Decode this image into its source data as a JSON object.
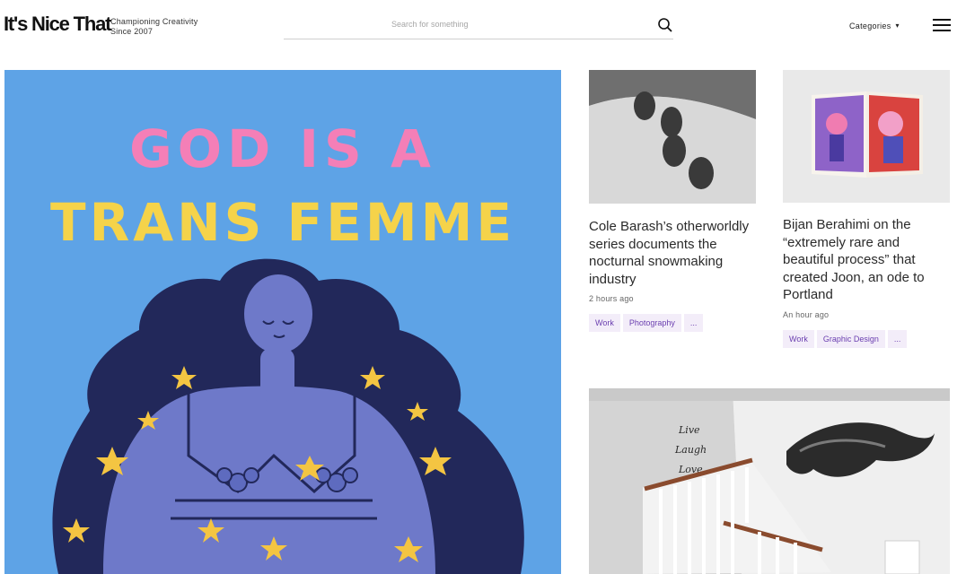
{
  "header": {
    "logo": "It's Nice That",
    "tagline_line1": "Championing Creativity",
    "tagline_line2": "Since 2007",
    "search_placeholder": "Search for something",
    "categories_label": "Categories"
  },
  "hero": {
    "line1": "GOD IS A",
    "line2": "TRANS FEMME",
    "bg_color": "#5ea3e6"
  },
  "articles": [
    {
      "title": "Cole Barash’s otherworldly series documents the nocturnal snowmaking industry",
      "time": "2 hours ago",
      "tags": [
        "Work",
        "Photography",
        "..."
      ]
    },
    {
      "title": "Bijan Berahimi on the “extremely rare and beautiful process” that created Joon, an ode to Portland",
      "time": "An hour ago",
      "tags": [
        "Work",
        "Graphic Design",
        "..."
      ]
    }
  ],
  "staircase_wall": {
    "l1": "Live",
    "l2": "Laugh",
    "l3": "Love"
  }
}
